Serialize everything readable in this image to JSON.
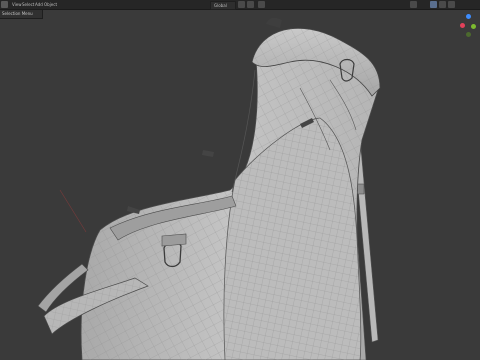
{
  "header": {
    "mode": "Object Mode",
    "menus": [
      "View",
      "Select",
      "Add",
      "Object"
    ],
    "transform_orientation": "Global"
  },
  "subheader": {
    "label": "Selection Menu"
  },
  "gizmo": {
    "axes": [
      "X",
      "Y",
      "Z"
    ],
    "colors": {
      "x": "#e2405a",
      "y": "#7cba2f",
      "z": "#3d8dff"
    }
  },
  "viewport": {
    "background": "#3a3a3a",
    "model": "golf-stand-bag-wireframe"
  }
}
